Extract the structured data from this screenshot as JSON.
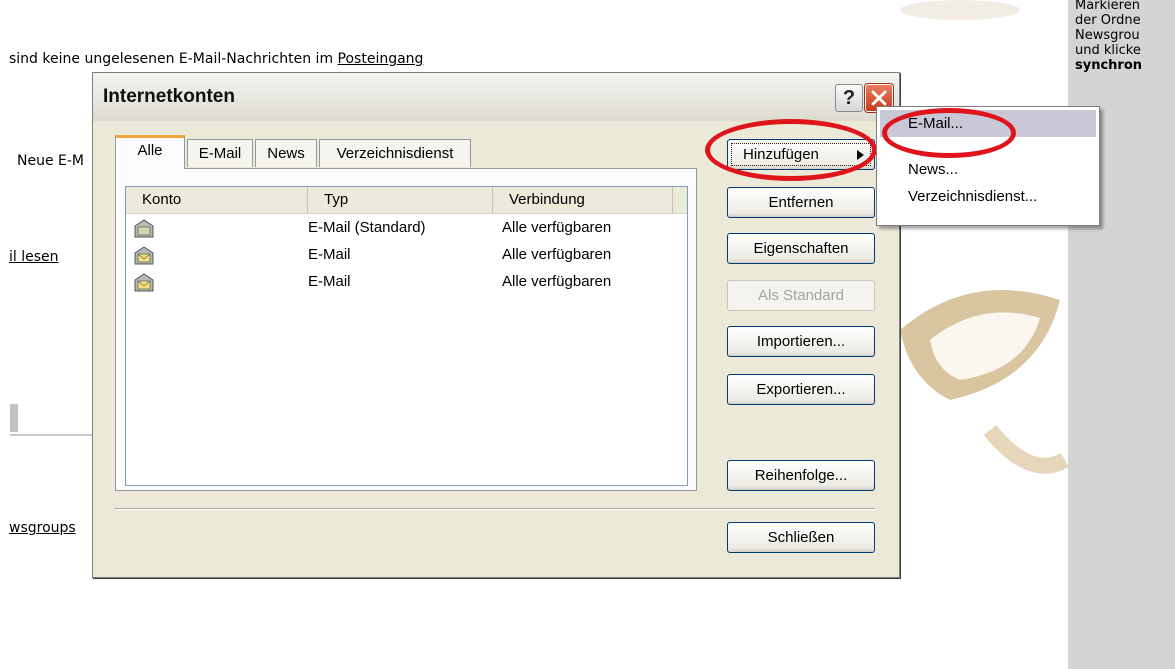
{
  "background": {
    "line1": "sind keine ungelesenen E-Mail-Nachrichten im ",
    "line1_link": "Posteingang",
    "line2": "Neue E-M",
    "line3_link": "il lesen",
    "line4_link": "wsgroups",
    "right_text": [
      "Markieren",
      "der Ordne",
      "Newsgrou",
      "und klicke"
    ],
    "right_text_bold": "synchron"
  },
  "dialog": {
    "title": "Internetkonten",
    "tabs": [
      "Alle",
      "E-Mail",
      "News",
      "Verzeichnisdienst"
    ],
    "columns": [
      "Konto",
      "Typ",
      "Verbindung"
    ],
    "rows": [
      {
        "konto": "",
        "typ": "E-Mail (Standard)",
        "verbindung": "Alle verfügbaren"
      },
      {
        "konto": "",
        "typ": "E-Mail",
        "verbindung": "Alle verfügbaren"
      },
      {
        "konto": "",
        "typ": "E-Mail",
        "verbindung": "Alle verfügbaren"
      }
    ],
    "buttons": {
      "add": "Hinzufügen",
      "remove": "Entfernen",
      "properties": "Eigenschaften",
      "set_default": "Als Standard",
      "import": "Importieren...",
      "export": "Exportieren...",
      "order": "Reihenfolge...",
      "close": "Schließen"
    }
  },
  "context_menu": {
    "items": [
      "E-Mail...",
      "News...",
      "Verzeichnisdienst..."
    ]
  },
  "colors": {
    "highlight_circle": "#e0141b",
    "menu_highlight": "#c8c8d6",
    "close_button": "#c8381a"
  }
}
